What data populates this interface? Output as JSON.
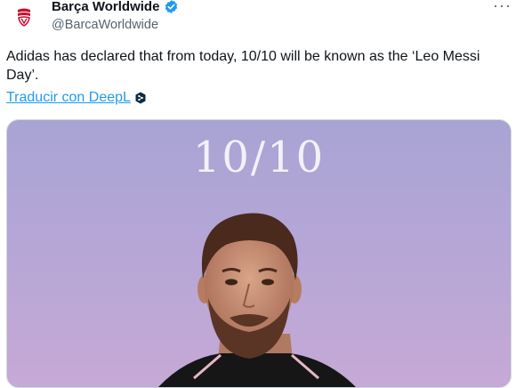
{
  "author": {
    "display_name": "Barça Worldwide",
    "handle": "@BarcaWorldwide",
    "verified": true,
    "avatar_icon": "barca-logo-icon"
  },
  "tweet": {
    "text": "Adidas has declared that from today, 10/10 will be known as the ‘Leo Messi Day’.",
    "translate_link": "Traducir con DeepL",
    "translate_icon": "deepl-icon"
  },
  "media": {
    "overlay_text": "10/10",
    "subject": "portrait-photo"
  },
  "colors": {
    "link": "#1d9bf0",
    "verified": "#1d9bf0",
    "secondary_text": "#536471"
  }
}
